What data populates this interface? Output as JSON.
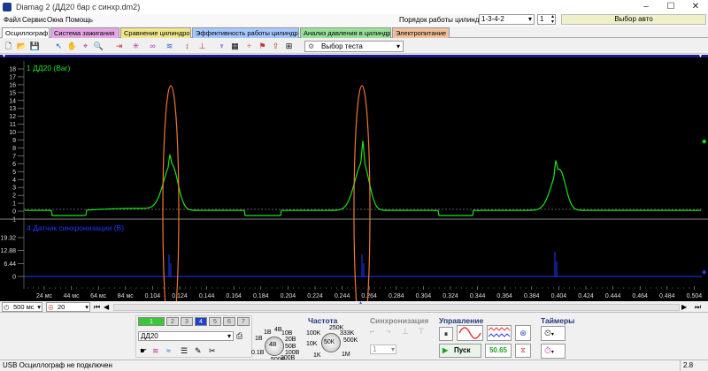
{
  "window": {
    "title": "Diamag 2 (ДД20 бар с синхр.dm2)"
  },
  "menu": {
    "items": [
      "Файл",
      "Сервис",
      "Окна",
      "Помощь"
    ]
  },
  "header": {
    "cyl_order_label": "Порядок работы цилиндров",
    "cyl_order_value": "1-3-4-2",
    "cyl_spin_value": "1",
    "auto_button": "Выбор авто"
  },
  "tabs": [
    {
      "label": "Осциллограф",
      "color": "#ffffff"
    },
    {
      "label": "Система зажигания",
      "color": "#e6a6e6"
    },
    {
      "label": "Сравнение цилиндров",
      "color": "#f0e68c"
    },
    {
      "label": "Эффективность работы цилиндров",
      "color": "#a6c8ff"
    },
    {
      "label": "Анализ давления в цилиндре",
      "color": "#98e098"
    },
    {
      "label": "Электропитание",
      "color": "#f0c09a"
    }
  ],
  "toolbar": {
    "test_select": "Выбор теста"
  },
  "channel1": {
    "label": "1 ДД20 (Bar)",
    "ticks": [
      "18",
      "17",
      "16",
      "15",
      "14",
      "13",
      "12",
      "11",
      "10",
      "9",
      "8",
      "7",
      "6",
      "5",
      "4",
      "3",
      "2",
      "1",
      "0",
      "-1"
    ],
    "color": "#19e619"
  },
  "channel4": {
    "label": "4 Датчик синхронизации (В)",
    "ticks": [
      "19.32",
      "12.88",
      "6.44",
      "0"
    ],
    "color": "#1a3cff"
  },
  "x_axis": {
    "ticks": [
      "24 мс",
      "44 мс",
      "64 мс",
      "84 мс",
      "0.104",
      "0.124",
      "0.144",
      "0.164",
      "0.184",
      "0.204",
      "0.224",
      "0.244",
      "0.264",
      "0.284",
      "0.304",
      "0.324",
      "0.344",
      "0.364",
      "0.384",
      "0.404",
      "0.424",
      "0.444",
      "0.464",
      "0.484",
      "0.504"
    ]
  },
  "bottom": {
    "time_scale": "500 мс",
    "zoom": "20"
  },
  "channels": {
    "buttons": [
      "1",
      "2",
      "3",
      "4",
      "5",
      "6",
      "7"
    ],
    "active": [
      "1",
      "4"
    ],
    "sensor_name": "ДД20"
  },
  "range_knob": {
    "labels": [
      "1В",
      "4В",
      "10В",
      "20В",
      "50В",
      "100В",
      "200В",
      "500В",
      "0.1В",
      "1В"
    ],
    "value": "4В"
  },
  "frequency": {
    "title": "Частота",
    "labels": [
      "100K",
      "250K",
      "333K",
      "500K",
      "1M",
      "1K",
      "10K"
    ],
    "value": "50К"
  },
  "sync": {
    "title": "Синхронизация",
    "select": "1"
  },
  "control": {
    "title": "Управление",
    "run": "Пуск",
    "value": "50.65"
  },
  "timers": {
    "title": "Таймеры"
  },
  "status": {
    "text": "USB Осциллограф не подключен",
    "right": "2.8"
  }
}
